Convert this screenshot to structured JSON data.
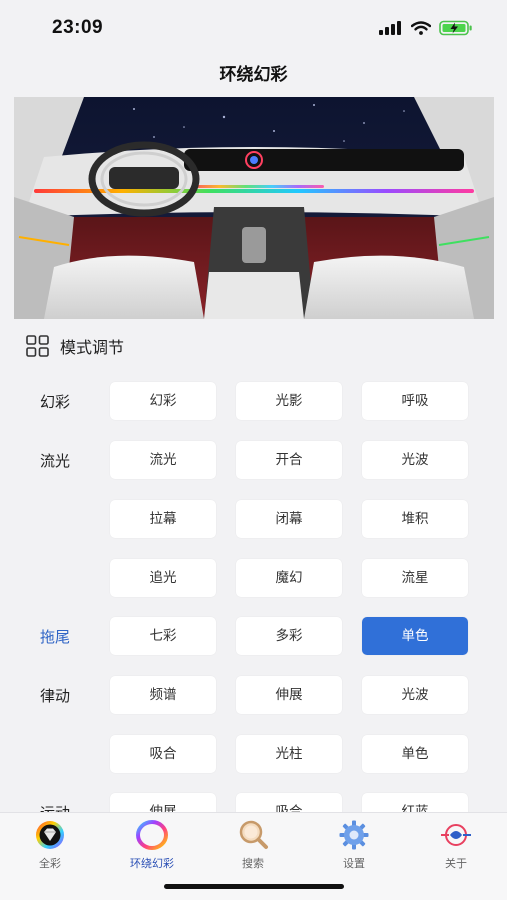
{
  "status": {
    "time": "23:09"
  },
  "header": {
    "title": "环绕幻彩"
  },
  "section": {
    "title": "模式调节"
  },
  "modes": [
    {
      "label": "幻彩",
      "active": false,
      "buttons": [
        "幻彩",
        "光影",
        "呼吸"
      ]
    },
    {
      "label": "流光",
      "active": false,
      "buttons": [
        "流光",
        "开合",
        "光波"
      ]
    },
    {
      "label": "",
      "active": false,
      "buttons": [
        "拉幕",
        "闭幕",
        "堆积"
      ]
    },
    {
      "label": "",
      "active": false,
      "buttons": [
        "追光",
        "魔幻",
        "流星"
      ]
    },
    {
      "label": "拖尾",
      "active": true,
      "buttons": [
        "七彩",
        "多彩",
        "单色"
      ],
      "selected": 2
    },
    {
      "label": "律动",
      "active": false,
      "buttons": [
        "频谱",
        "伸展",
        "光波"
      ]
    },
    {
      "label": "",
      "active": false,
      "buttons": [
        "吸合",
        "光柱",
        "单色"
      ]
    },
    {
      "label": "运动",
      "active": false,
      "buttons": [
        "伸展",
        "吸合",
        "红蓝"
      ]
    }
  ],
  "tabs": [
    {
      "label": "全彩",
      "icon": "diamond-icon",
      "active": false
    },
    {
      "label": "环绕幻彩",
      "icon": "rainbow-ring-icon",
      "active": true
    },
    {
      "label": "搜索",
      "icon": "search-icon",
      "active": false
    },
    {
      "label": "设置",
      "icon": "gear-icon",
      "active": false
    },
    {
      "label": "关于",
      "icon": "brand-logo-icon",
      "active": false
    }
  ],
  "colors": {
    "accent": "#3070d8",
    "active_label": "#2f64c6",
    "tab_active": "#2a4fb5",
    "background": "#f2f2f4"
  }
}
